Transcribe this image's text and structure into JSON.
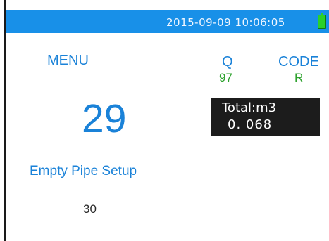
{
  "status_bar": {
    "datetime": "2015-09-09 10:06:05",
    "battery_icon": "battery-icon",
    "color": "#1890e8"
  },
  "menu": {
    "label": "MENU",
    "number": "29"
  },
  "readout": {
    "q_label": "Q",
    "q_value": "97",
    "code_label": "CODE",
    "code_value": "R"
  },
  "total": {
    "label": "Total:m3",
    "value": "0. 068"
  },
  "setting": {
    "name": "Empty Pipe Setup",
    "value": "30"
  },
  "colors": {
    "accent": "#1a82d8",
    "value_green": "#2ba12b",
    "panel": "#1c1c1c"
  }
}
